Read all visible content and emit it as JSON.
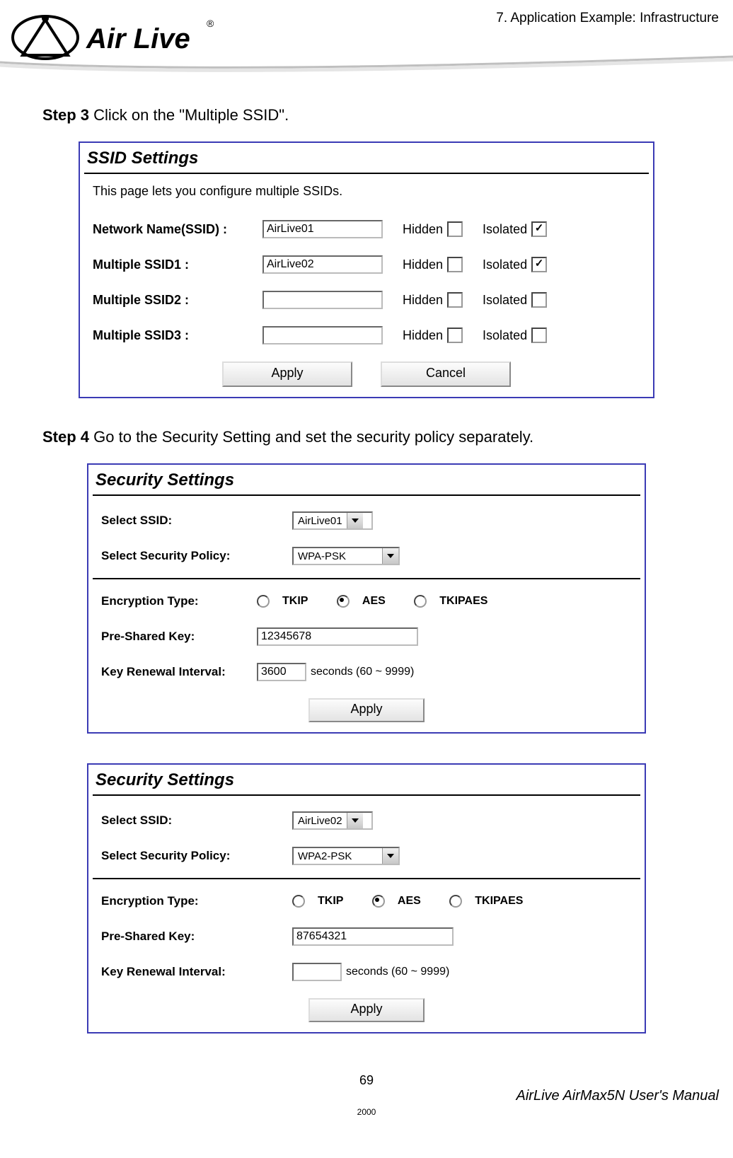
{
  "header": {
    "chapter": "7. Application Example: Infrastructure",
    "logo_text_1": "Air Live",
    "logo_mark": "®"
  },
  "steps": {
    "s3_label": "Step 3",
    "s3_text": "  Click on the \"Multiple SSID\".",
    "s4_label": "Step 4",
    "s4_text": "  Go to the Security Setting and set the security policy separately."
  },
  "ssid_panel": {
    "title": "SSID Settings",
    "desc": "This page lets you configure multiple SSIDs.",
    "rows": [
      {
        "label": "Network Name(SSID) :",
        "value": "AirLive01",
        "hidden": false,
        "isolated": true
      },
      {
        "label": "Multiple SSID1 :",
        "value": "AirLive02",
        "hidden": false,
        "isolated": true
      },
      {
        "label": "Multiple SSID2 :",
        "value": "",
        "hidden": false,
        "isolated": false
      },
      {
        "label": "Multiple SSID3 :",
        "value": "",
        "hidden": false,
        "isolated": false
      }
    ],
    "hidden_label": "Hidden",
    "isolated_label": "Isolated",
    "apply": "Apply",
    "cancel": "Cancel"
  },
  "sec_panel_1": {
    "title": "Security Settings",
    "select_ssid_label": "Select SSID:",
    "select_ssid_value": "AirLive01",
    "select_policy_label": "Select Security Policy:",
    "select_policy_value": "WPA-PSK",
    "enc_label": "Encryption Type:",
    "enc_options": {
      "tkip": "TKIP",
      "aes": "AES",
      "tkipaes": "TKIPAES"
    },
    "enc_selected": "aes",
    "psk_label": "Pre-Shared Key:",
    "psk_value": "12345678",
    "renew_label": "Key Renewal Interval:",
    "renew_value": "3600",
    "renew_unit": "seconds   (60 ~ 9999)",
    "apply": "Apply"
  },
  "sec_panel_2": {
    "title": "Security Settings",
    "select_ssid_label": "Select SSID:",
    "select_ssid_value": "AirLive02",
    "select_policy_label": "Select Security Policy:",
    "select_policy_value": "WPA2-PSK",
    "enc_label": "Encryption Type:",
    "enc_options": {
      "tkip": "TKIP",
      "aes": "AES",
      "tkipaes": "TKIPAES"
    },
    "enc_selected": "aes",
    "psk_label": "Pre-Shared Key:",
    "psk_value": "87654321",
    "renew_label": "Key Renewal Interval:",
    "renew_value": "",
    "renew_unit": "seconds   (60 ~ 9999)",
    "apply": "Apply"
  },
  "footer": {
    "page_number": "69",
    "manual_title": "AirLive AirMax5N User's Manual",
    "small": "2000"
  }
}
